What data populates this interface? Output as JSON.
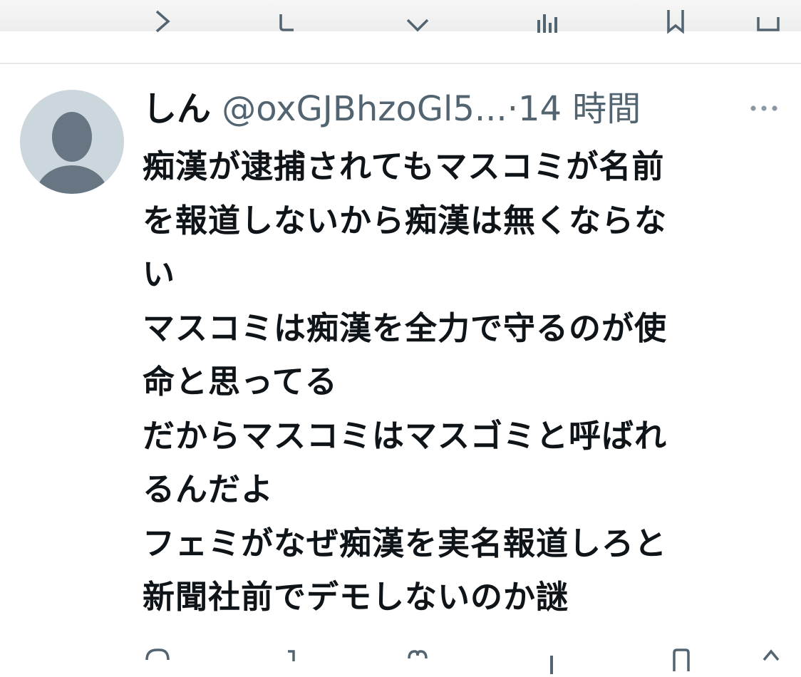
{
  "tweet": {
    "display_name": "しん",
    "handle": "@oxGJBhzoGl5...",
    "separator": "·",
    "time": "14 時間",
    "lines": [
      "痴漢が逮捕されてもマスコミが名前",
      "を報道しないから痴漢は無くならな",
      "い",
      "マスコミは痴漢を全力で守るのが使",
      "命と思ってる",
      "だからマスコミはマスゴミと呼ばれ",
      "るんだよ",
      "フェミがなぜ痴漢を実名報道しろと",
      "新聞社前でデモしないのか謎"
    ]
  },
  "icons": {
    "avatar": "default-profile-icon",
    "more": "more-horizontal-icon",
    "reply": "reply-icon",
    "retweet": "retweet-icon",
    "like": "heart-icon",
    "views": "views-icon",
    "bookmark": "bookmark-icon",
    "share": "share-icon"
  },
  "colors": {
    "text_primary": "#0f1419",
    "text_secondary": "#536471",
    "avatar_bg": "#ccd6dd",
    "avatar_fg": "#687684",
    "divider": "#e6e9ec"
  }
}
